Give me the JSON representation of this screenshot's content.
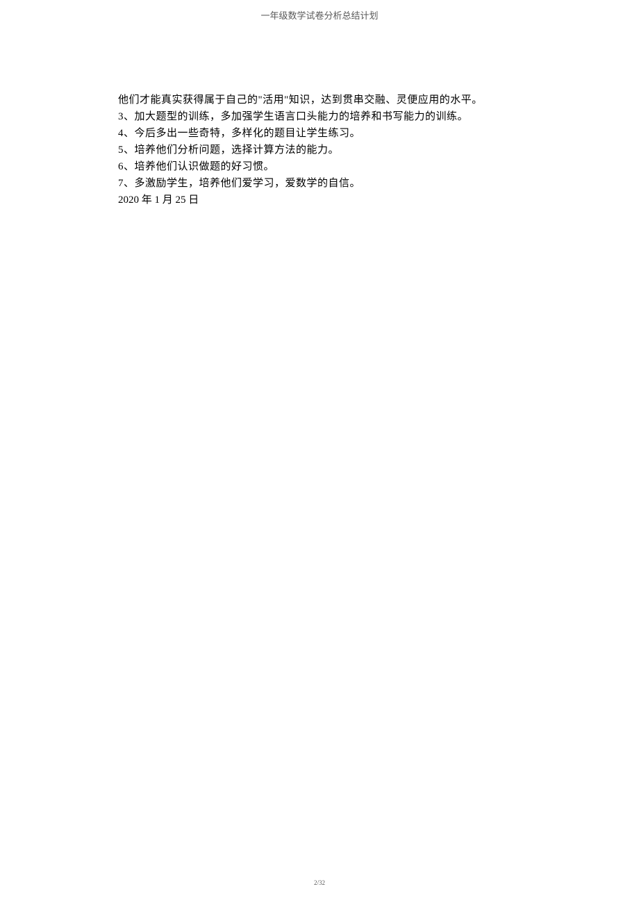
{
  "header": {
    "title": "一年级数学试卷分析总结计划"
  },
  "body": {
    "lines": [
      "他们才能真实获得属于自己的\"活用\"知识，达到贯串交融、灵便应用的水平。",
      "3、加大题型的训练，多加强学生语言口头能力的培养和书写能力的训练。",
      "4、今后多出一些奇特，多样化的题目让学生练习。",
      "5、培养他们分析问题，选择计算方法的能力。",
      "6、培养他们认识做题的好习惯。",
      "7、多激励学生，培养他们爱学习，爱数学的自信。"
    ],
    "date": {
      "year": "2020",
      "year_suffix": " 年 ",
      "month": "1",
      "month_suffix": " 月 ",
      "day": "25",
      "day_suffix": " 日"
    }
  },
  "footer": {
    "page_current": "2",
    "page_separator": "/",
    "page_total": "32"
  }
}
